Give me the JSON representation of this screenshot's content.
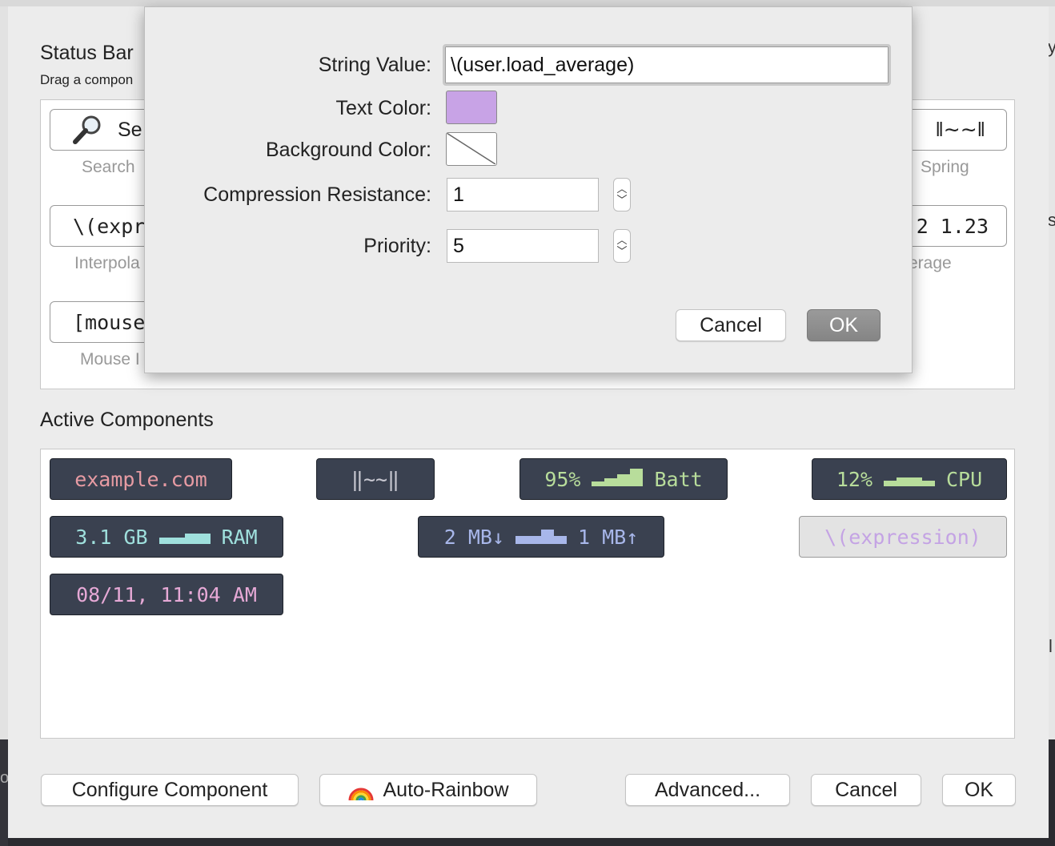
{
  "colors": {
    "chip_bg": "#3a4150",
    "domain_text": "#e79ba3",
    "green_text": "#b8dd9b",
    "cyan_text": "#9fe0dd",
    "blue_text": "#a8b7ea",
    "pink_text": "#e6a9d6",
    "divider_text": "#c9c9d2",
    "text_color_swatch": "#c8a3e6",
    "selected_chip_text": "#c4a3e4"
  },
  "background_window": {
    "title": "Status Bar",
    "subtitle": "Drag a compon",
    "right_edge_chars": [
      "y",
      "s",
      "l"
    ],
    "left_edge_char": "o",
    "palette": {
      "items": [
        {
          "icon": "magnifying-glass-icon",
          "text": "Se",
          "caption": "Search"
        },
        {
          "text": "\\(expr",
          "caption": "Interpola"
        },
        {
          "text": "[mouse",
          "caption": "Mouse I"
        },
        {
          "text": "‖∼∼‖",
          "caption": "Spring"
        },
        {
          "text": "2 1.23",
          "caption": "erage"
        }
      ]
    },
    "active_components_title": "Active Components",
    "active_components": {
      "example": "example.com",
      "spring": "‖∼∼‖",
      "battery": {
        "value": "95%",
        "label": "Batt"
      },
      "cpu": {
        "value": "12%",
        "label": "CPU"
      },
      "ram": {
        "value": "3.1 GB",
        "label": "RAM"
      },
      "network": {
        "down": "2 MB↓",
        "up": "1 MB↑"
      },
      "expression": "\\(expression)",
      "datetime": "08/11, 11:04 AM"
    },
    "buttons": {
      "configure": "Configure Component",
      "auto_rainbow": "Auto-Rainbow",
      "auto_rainbow_icon": "rainbow-icon",
      "advanced": "Advanced...",
      "cancel": "Cancel",
      "ok": "OK"
    }
  },
  "dialog": {
    "string_value_label": "String Value:",
    "string_value": "\\(user.load_average)",
    "text_color_label": "Text Color:",
    "background_color_label": "Background Color:",
    "compression_label": "Compression Resistance:",
    "compression_value": "1",
    "priority_label": "Priority:",
    "priority_value": "5",
    "cancel": "Cancel",
    "ok": "OK"
  }
}
